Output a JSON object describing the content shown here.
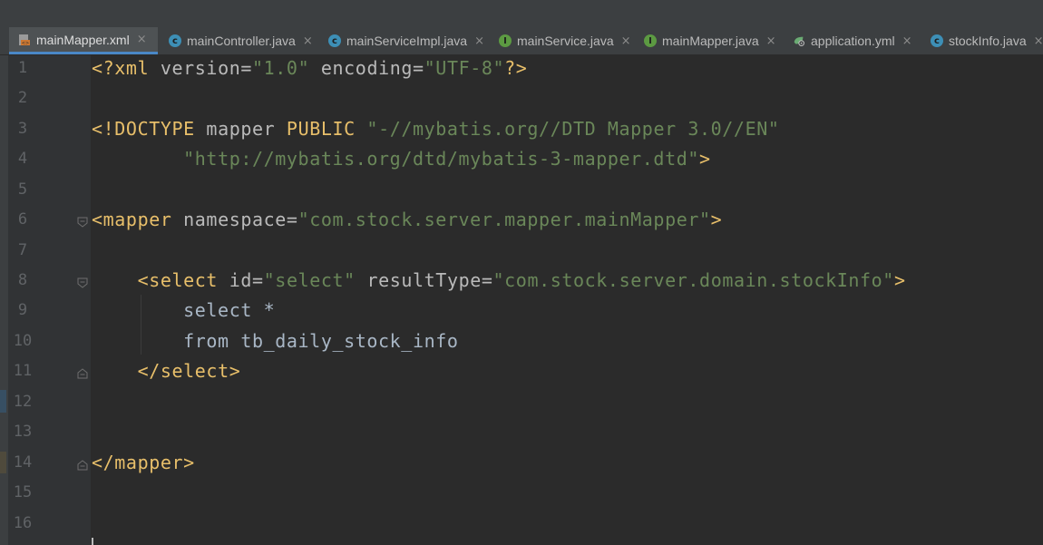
{
  "tabs": [
    {
      "label": "mainMapper.xml",
      "icon": "xml-file-icon",
      "active": true
    },
    {
      "label": "mainController.java",
      "icon": "class-icon",
      "active": false
    },
    {
      "label": "mainServiceImpl.java",
      "icon": "class-icon",
      "active": false
    },
    {
      "label": "mainService.java",
      "icon": "interface-icon",
      "active": false
    },
    {
      "label": "mainMapper.java",
      "icon": "interface-icon",
      "active": false
    },
    {
      "label": "application.yml",
      "icon": "yml-file-icon",
      "active": false
    },
    {
      "label": "stockInfo.java",
      "icon": "class-icon",
      "active": false
    }
  ],
  "tab_close_glyph": "×",
  "icon_letters": {
    "class": "c",
    "interface": "I"
  },
  "line_numbers": [
    "1",
    "2",
    "3",
    "4",
    "5",
    "6",
    "7",
    "8",
    "9",
    "10",
    "11",
    "12",
    "13",
    "14",
    "15",
    "16"
  ],
  "code": {
    "l1": {
      "open": "<?xml ",
      "a1": "version=",
      "v1": "\"1.0\"",
      "sp": " ",
      "a2": "encoding=",
      "v2": "\"UTF-8\"",
      "close": "?>"
    },
    "l3": {
      "tag": "<!DOCTYPE ",
      "name": "mapper ",
      "kw": "PUBLIC ",
      "val": "\"-//mybatis.org//DTD Mapper 3.0//EN\""
    },
    "l4": {
      "indent": "        ",
      "val": "\"http://mybatis.org/dtd/mybatis-3-mapper.dtd\"",
      "close": ">"
    },
    "l6": {
      "tag": "<mapper ",
      "attr": "namespace=",
      "val": "\"com.stock.server.mapper.mainMapper\"",
      "close": ">"
    },
    "l8": {
      "indent": "    ",
      "tag": "<select ",
      "a1": "id=",
      "v1": "\"select\"",
      "sp": " ",
      "a2": "resultType=",
      "v2": "\"com.stock.server.domain.stockInfo\"",
      "close": ">"
    },
    "l9": {
      "text": "        select *"
    },
    "l10": {
      "text": "        from tb_daily_stock_info"
    },
    "l11": {
      "indent": "    ",
      "tag": "</select>"
    },
    "l14": {
      "tag": "</mapper>"
    }
  },
  "colors": {
    "tag": "#e8bf6a",
    "attribute": "#bababa",
    "string": "#6a8759",
    "text": "#a9b7c6",
    "active_tab_underline": "#4a88c7"
  }
}
